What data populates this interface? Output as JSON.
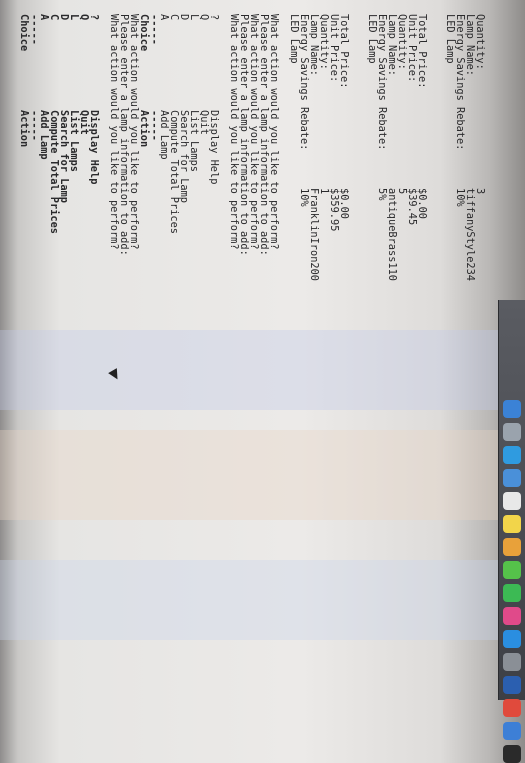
{
  "terminal": {
    "header": {
      "choice": "Choice",
      "action": "Action",
      "rule": "-----"
    },
    "menu1": [
      {
        "key": "A",
        "label": "Add Lamp"
      },
      {
        "key": "C",
        "label": "Compute Total Prices"
      },
      {
        "key": "D",
        "label": "Search for Lamp"
      },
      {
        "key": "L",
        "label": "List Lamps"
      },
      {
        "key": "Q",
        "label": "Quit"
      },
      {
        "key": "?",
        "label": "Display Help"
      }
    ],
    "prompt1": "What action would you like to perform?",
    "prompt2": "Please enter a lamp information to add:",
    "prompt3": "What action would you like to perform?",
    "menu2": [
      {
        "key": "A",
        "label": "Add Lamp"
      },
      {
        "key": "C",
        "label": "Compute Total Prices"
      },
      {
        "key": "D",
        "label": "Search for Lamp"
      },
      {
        "key": "L",
        "label": "List Lamps"
      },
      {
        "key": "Q",
        "label": "Quit"
      },
      {
        "key": "?",
        "label": "Display Help"
      }
    ],
    "prompts2": [
      "What action would you like to perform?",
      "Please enter a lamp information to add:",
      "What action would you like to perform?",
      "Please enter a lamp information to add:",
      "What action would you like to perform?"
    ],
    "lamp1": {
      "type": "LED Lamp",
      "rows": [
        {
          "label": "Energy Savings Rebate:",
          "value": "10%"
        },
        {
          "label": "Lamp Name:",
          "value": "FranklinIron200"
        },
        {
          "label": "Quantity:",
          "value": "1"
        },
        {
          "label": "Unit Price:",
          "value": "$359.95"
        },
        {
          "label": "Total Price:",
          "value": "$0.00"
        }
      ]
    },
    "lamp2": {
      "type": "LED Lamp",
      "rows": [
        {
          "label": "Energy Savings Rebate:",
          "value": "5%"
        },
        {
          "label": "Lamp Name:",
          "value": "antiqueBrass110"
        },
        {
          "label": "Quantity:",
          "value": "5"
        },
        {
          "label": "Unit Price:",
          "value": "$39.45"
        },
        {
          "label": "Total Price:",
          "value": "$0.00"
        }
      ]
    },
    "lamp3": {
      "type": "LED Lamp",
      "rows": [
        {
          "label": "Energy Savings Rebate:",
          "value": "10%"
        },
        {
          "label": "Lamp Name:",
          "value": "tiffanyStyle234"
        },
        {
          "label": "Quantity:",
          "value": "3"
        }
      ]
    }
  },
  "dock": {
    "icons": [
      {
        "name": "finder-icon",
        "color": "#3b82d6"
      },
      {
        "name": "launchpad-icon",
        "color": "#9aa3ad"
      },
      {
        "name": "safari-icon",
        "color": "#2f9be0"
      },
      {
        "name": "mail-icon",
        "color": "#4a90d9"
      },
      {
        "name": "calendar-icon",
        "color": "#e8e8e8"
      },
      {
        "name": "notes-icon",
        "color": "#f2d54a"
      },
      {
        "name": "photos-icon",
        "color": "#e8a13a"
      },
      {
        "name": "messages-icon",
        "color": "#55c24a"
      },
      {
        "name": "facetime-icon",
        "color": "#3cba54"
      },
      {
        "name": "itunes-icon",
        "color": "#e04a8a"
      },
      {
        "name": "appstore-icon",
        "color": "#2a8ee0"
      },
      {
        "name": "preferences-icon",
        "color": "#8a8f96"
      },
      {
        "name": "word-icon",
        "color": "#2b5fb0"
      },
      {
        "name": "chrome-icon",
        "color": "#e04a3c"
      },
      {
        "name": "xcode-icon",
        "color": "#3d7fd6"
      },
      {
        "name": "terminal-icon",
        "color": "#2a2a2a"
      }
    ]
  }
}
